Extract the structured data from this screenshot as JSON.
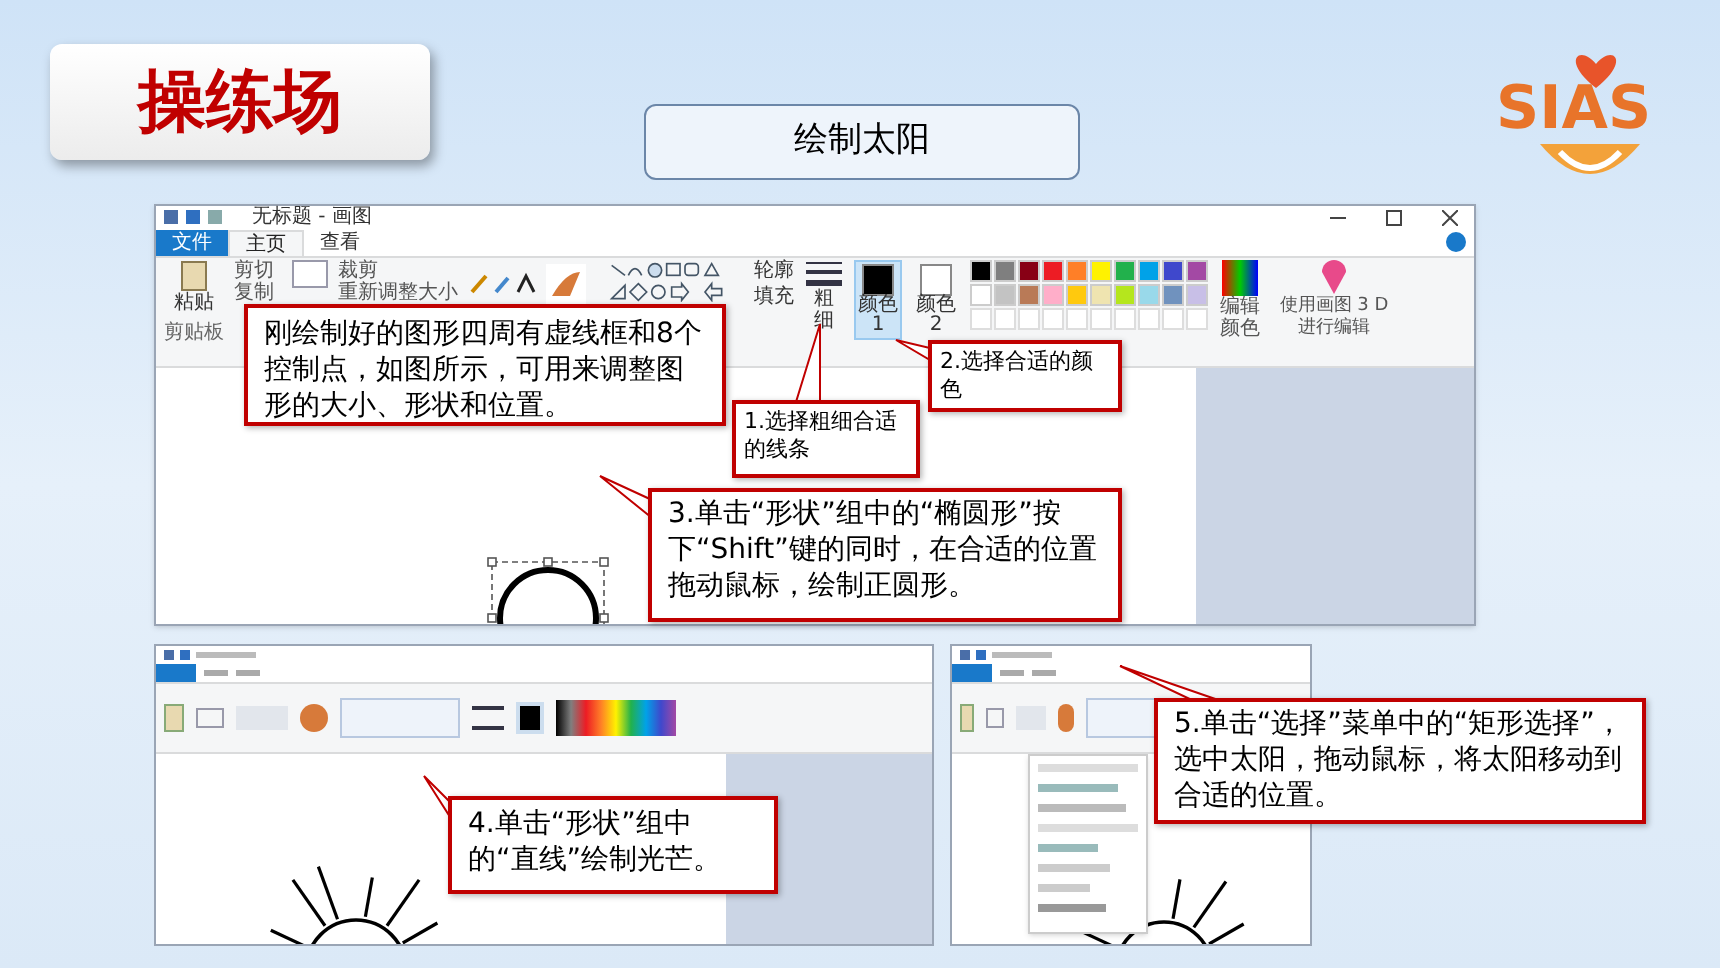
{
  "header": {
    "badge": "操练场",
    "title": "绘制太阳",
    "logo_text": "SIAS"
  },
  "main_window": {
    "title": "无标题 - 画图",
    "tabs": [
      {
        "label": "文件",
        "kind": "file",
        "selected": false
      },
      {
        "label": "主页",
        "kind": "tab",
        "selected": true
      },
      {
        "label": "查看",
        "kind": "tab",
        "selected": false
      }
    ],
    "clipboard": {
      "paste": "粘贴",
      "cut": "剪切",
      "copy": "复制",
      "group": "剪贴板"
    },
    "image": {
      "crop": "裁剪",
      "resize": "重新调整大小"
    },
    "shapes": {
      "outline": "轮廓",
      "fill": "填充"
    },
    "size": {
      "label": "粗细"
    },
    "color_slots": [
      {
        "label": "颜色 1",
        "selected": true,
        "color": "#000000"
      },
      {
        "label": "颜色 2",
        "selected": false,
        "color": "#ffffff"
      }
    ],
    "palette": [
      {
        "color": "#000000"
      },
      {
        "color": "#7f7f7f"
      },
      {
        "color": "#880015"
      },
      {
        "color": "#ed1c24"
      },
      {
        "color": "#ff7f27"
      },
      {
        "color": "#fff200"
      },
      {
        "color": "#22b14c"
      },
      {
        "color": "#00a2e8"
      },
      {
        "color": "#3f48cc"
      },
      {
        "color": "#a349a4"
      },
      {
        "color": "#ffffff"
      },
      {
        "color": "#c3c3c3"
      },
      {
        "color": "#b97a57"
      },
      {
        "color": "#ffaec9"
      },
      {
        "color": "#ffc90e"
      },
      {
        "color": "#efe4b0"
      },
      {
        "color": "#b5e61d"
      },
      {
        "color": "#99d9ea"
      },
      {
        "color": "#7092be"
      },
      {
        "color": "#c8bfe7"
      }
    ],
    "edit_colors": "编辑颜色",
    "paint3d": "使用画图 3 D 进行编辑"
  },
  "callouts": [
    {
      "text": "刚绘制好的图形四周有虚线框和8个控制点，如图所示，可用来调整图形的大小、形状和位置。"
    },
    {
      "text": "1.选择粗细合适的线条"
    },
    {
      "text": "2.选择合适的颜色"
    },
    {
      "text": "3.单击“形状”组中的“椭圆形”按下“Shift”键的同时，在合适的位置拖动鼠标，绘制正圆形。"
    },
    {
      "text": "4.单击“形状”组中的“直线”绘制光芒。"
    },
    {
      "text": "5.单击“选择”菜单中的“矩形选择”，选中太阳，拖动鼠标，将太阳移动到合适的位置。"
    }
  ]
}
